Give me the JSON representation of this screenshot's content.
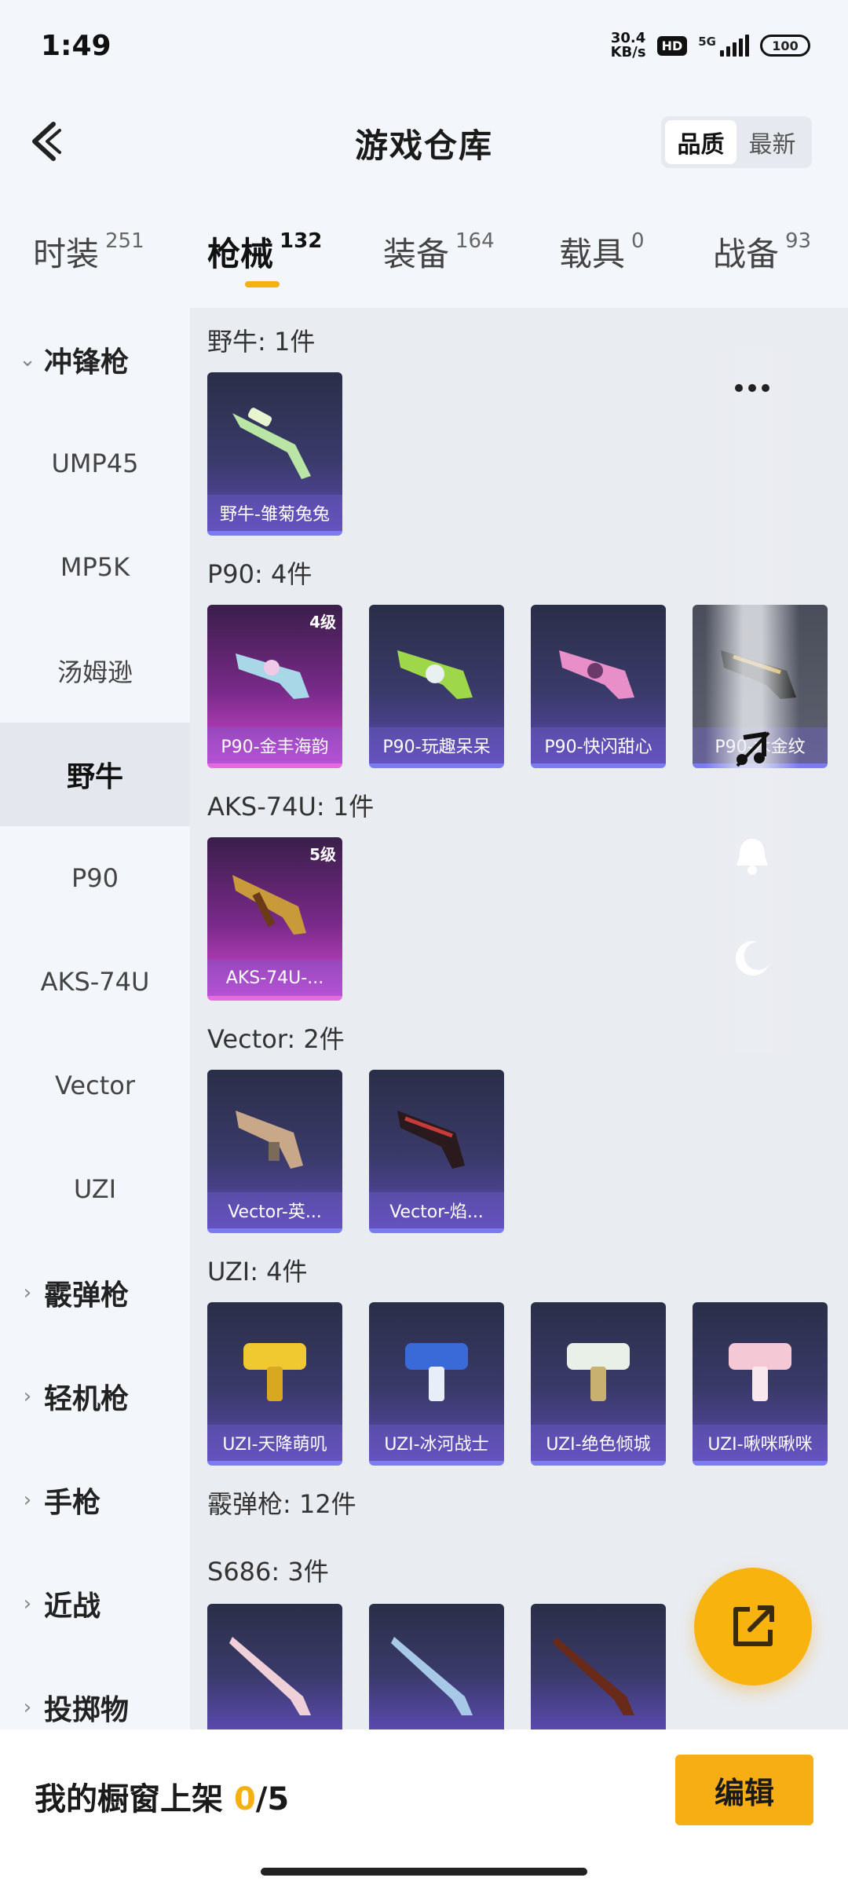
{
  "status": {
    "time": "1:49",
    "speed_top": "30.4",
    "speed_unit": "KB/s",
    "hd": "HD",
    "network": "5G",
    "battery": "100"
  },
  "header": {
    "title": "游戏仓库",
    "sort_quality": "品质",
    "sort_newest": "最新"
  },
  "tabs": [
    {
      "label": "时装",
      "count": "251"
    },
    {
      "label": "枪械",
      "count": "132"
    },
    {
      "label": "装备",
      "count": "164"
    },
    {
      "label": "载具",
      "count": "0"
    },
    {
      "label": "战备",
      "count": "93"
    }
  ],
  "sidebar": {
    "group_smg": "冲锋枪",
    "items": [
      "UMP45",
      "MP5K",
      "汤姆逊",
      "野牛",
      "P90",
      "AKS-74U",
      "Vector",
      "UZI"
    ],
    "groups": [
      "霰弹枪",
      "轻机枪",
      "手枪",
      "近战",
      "投掷物"
    ]
  },
  "sections": {
    "bizon": {
      "title": "野牛: 1件",
      "cards": [
        "野牛-雏菊兔兔"
      ]
    },
    "p90": {
      "title": "P90: 4件",
      "cards": [
        "P90-金丰海韵",
        "P90-玩趣呆呆",
        "P90-快闪甜心",
        "P90-木金纹"
      ],
      "level": "4级"
    },
    "aks": {
      "title": "AKS-74U: 1件",
      "cards": [
        "AKS-74U-..."
      ],
      "level": "5级"
    },
    "vector": {
      "title": "Vector: 2件",
      "cards": [
        "Vector-英...",
        "Vector-焰..."
      ]
    },
    "uzi": {
      "title": "UZI: 4件",
      "cards": [
        "UZI-天降萌叽",
        "UZI-冰河战士",
        "UZI-绝色倾城",
        "UZI-啾咪啾咪"
      ]
    },
    "shotgun": {
      "title": "霰弹枪: 12件"
    },
    "s686": {
      "title": "S686: 3件"
    }
  },
  "bottom": {
    "showcase_label": "我的橱窗上架 ",
    "showcase_count": "0",
    "showcase_total": "/5",
    "edit": "编辑"
  },
  "colors": {
    "accent": "#f5b014",
    "card_purple": "#5b4ab0",
    "card_pink": "#d54ad0"
  },
  "icons": [
    "back-arrow-icon",
    "more-icon",
    "music-off-icon",
    "bell-icon",
    "moon-icon",
    "share-icon"
  ]
}
